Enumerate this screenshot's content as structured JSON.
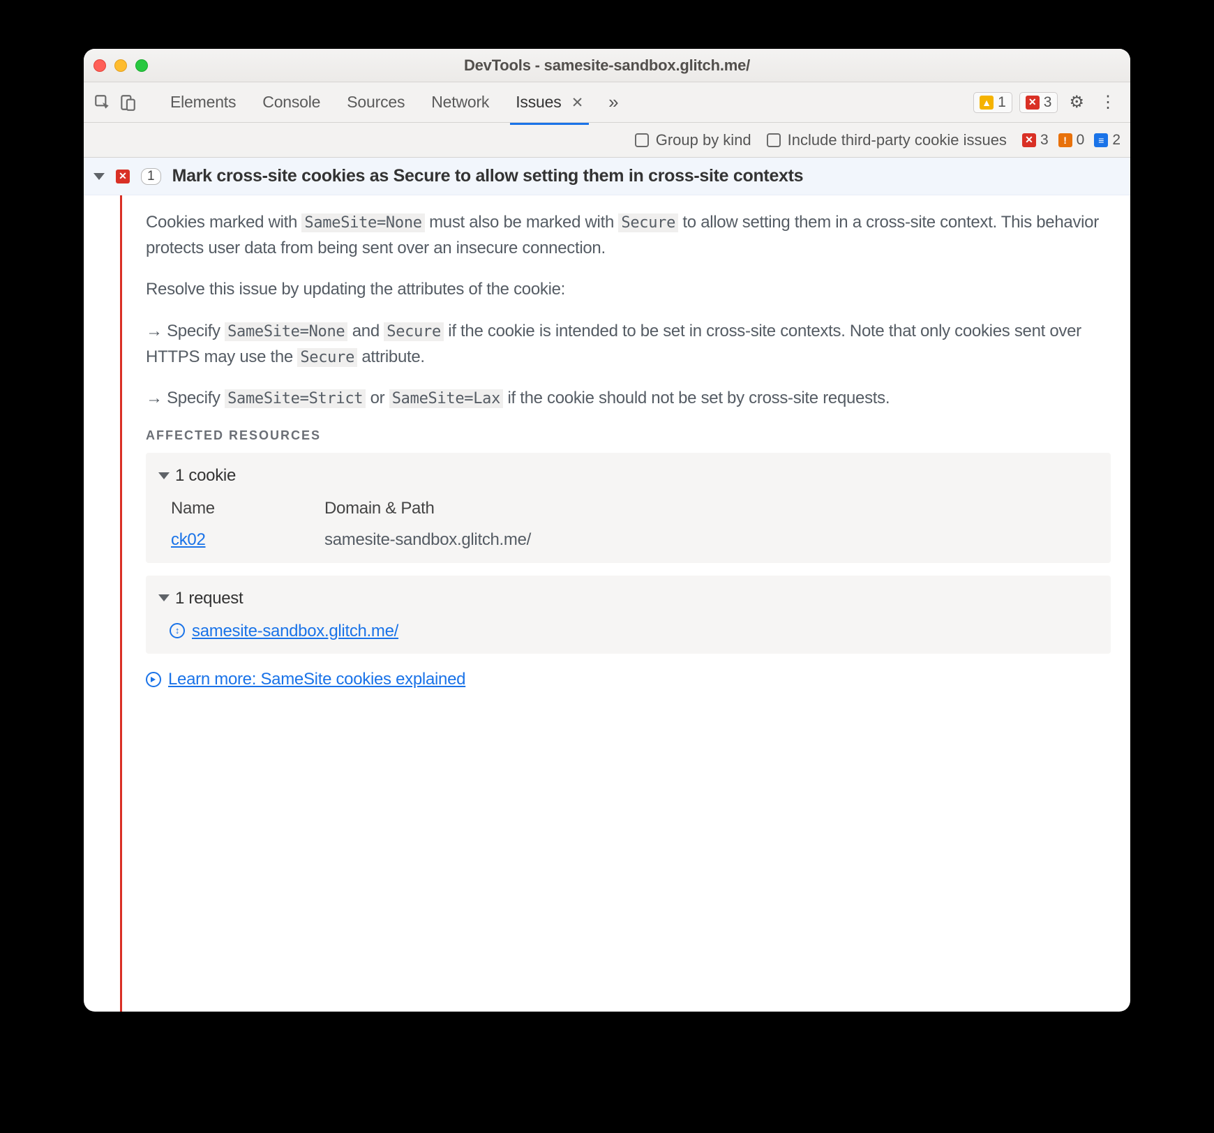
{
  "window": {
    "title": "DevTools - samesite-sandbox.glitch.me/"
  },
  "tabs": {
    "items": [
      {
        "label": "Elements"
      },
      {
        "label": "Console"
      },
      {
        "label": "Sources"
      },
      {
        "label": "Network"
      },
      {
        "label": "Issues",
        "active": true,
        "closeable": true
      }
    ]
  },
  "toolbar_badges": {
    "warnings": "1",
    "errors": "3"
  },
  "filterbar": {
    "group_label": "Group by kind",
    "third_party_label": "Include third-party cookie issues",
    "red": "3",
    "orange": "0",
    "blue": "2"
  },
  "issue": {
    "count": "1",
    "title": "Mark cross-site cookies as Secure to allow setting them in cross-site contexts"
  },
  "detail": {
    "p1a": "Cookies marked with ",
    "p1_code1": "SameSite=None",
    "p1b": " must also be marked with ",
    "p1_code2": "Secure",
    "p1c": " to allow setting them in a cross-site context. This behavior protects user data from being sent over an insecure connection.",
    "p2": "Resolve this issue by updating the attributes of the cookie:",
    "b1a": "Specify ",
    "b1_code1": "SameSite=None",
    "b1b": " and ",
    "b1_code2": "Secure",
    "b1c": " if the cookie is intended to be set in cross-site contexts. Note that only cookies sent over HTTPS may use the ",
    "b1_code3": "Secure",
    "b1d": " attribute.",
    "b2a": "Specify ",
    "b2_code1": "SameSite=Strict",
    "b2b": " or ",
    "b2_code2": "SameSite=Lax",
    "b2c": " if the cookie should not be set by cross-site requests."
  },
  "affected": {
    "heading": "Affected Resources",
    "cookies": {
      "summary": "1 cookie",
      "col_name": "Name",
      "col_domain": "Domain & Path",
      "rows": [
        {
          "name": "ck02",
          "domain": "samesite-sandbox.glitch.me/"
        }
      ]
    },
    "requests": {
      "summary": "1 request",
      "rows": [
        {
          "url": "samesite-sandbox.glitch.me/"
        }
      ]
    }
  },
  "learn_more": "Learn more: SameSite cookies explained"
}
